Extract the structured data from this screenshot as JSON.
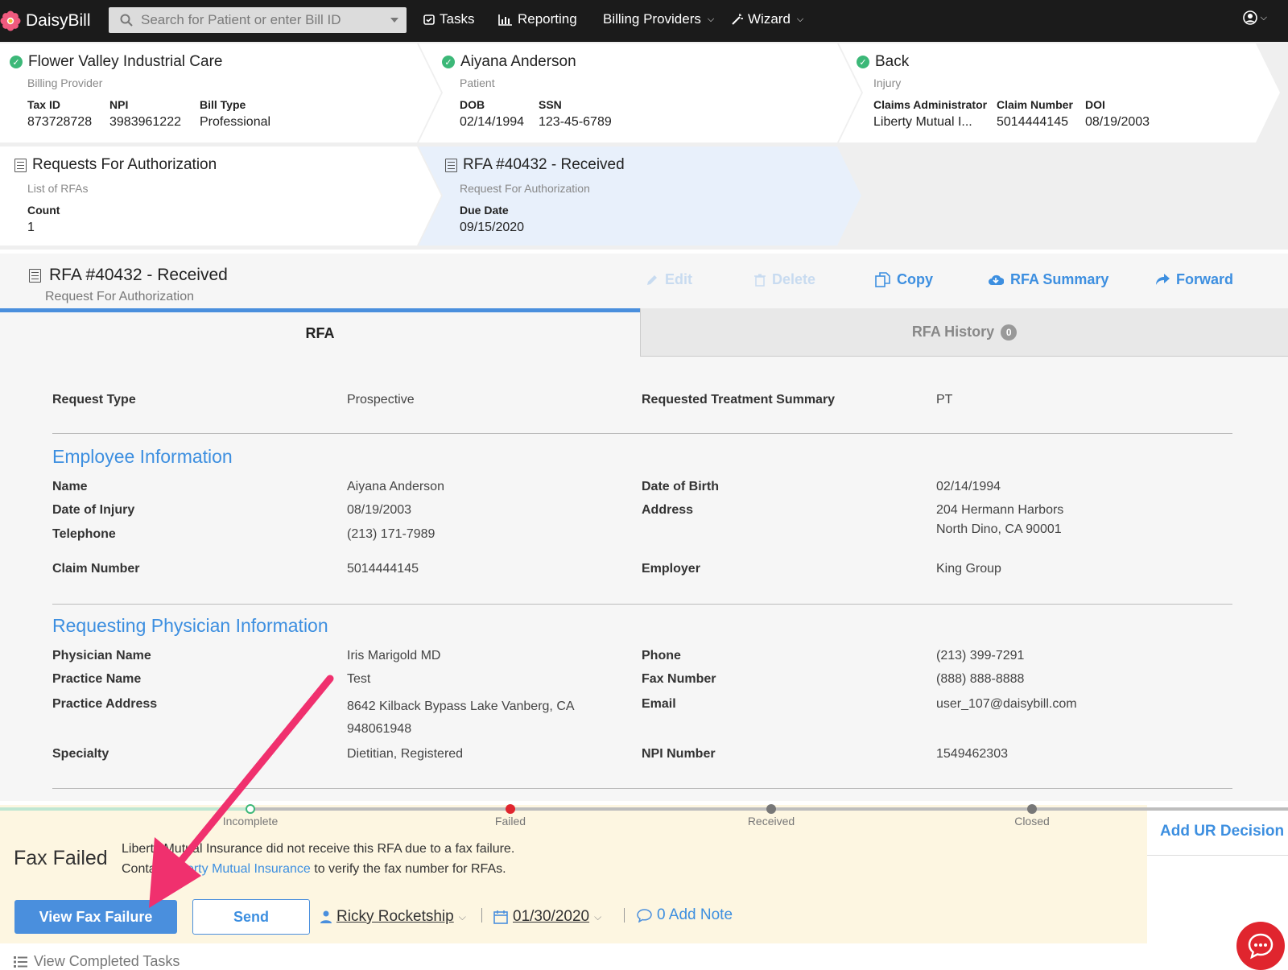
{
  "nav": {
    "brand": "DaisyBill",
    "search_placeholder": "Search for Patient or enter Bill ID",
    "tasks": "Tasks",
    "reporting": "Reporting",
    "billing_providers": "Billing Providers",
    "wizard": "Wizard"
  },
  "crumbs": {
    "provider": {
      "title": "Flower Valley Industrial Care",
      "subtitle": "Billing Provider",
      "fields": [
        {
          "label": "Tax ID",
          "value": "873728728"
        },
        {
          "label": "NPI",
          "value": "3983961222"
        },
        {
          "label": "Bill Type",
          "value": "Professional"
        }
      ]
    },
    "patient": {
      "title": "Aiyana Anderson",
      "subtitle": "Patient",
      "fields": [
        {
          "label": "DOB",
          "value": "02/14/1994"
        },
        {
          "label": "SSN",
          "value": "123-45-6789"
        }
      ]
    },
    "injury": {
      "title": "Back",
      "subtitle": "Injury",
      "fields": [
        {
          "label": "Claims Administrator",
          "value": "Liberty Mutual I..."
        },
        {
          "label": "Claim Number",
          "value": "5014444145"
        },
        {
          "label": "DOI",
          "value": "08/19/2003"
        }
      ]
    },
    "rfas": {
      "title": "Requests For Authorization",
      "subtitle": "List of RFAs",
      "fields": [
        {
          "label": "Count",
          "value": "1"
        }
      ]
    },
    "rfa": {
      "title": "RFA #40432 - Received",
      "subtitle": "Request For Authorization",
      "fields": [
        {
          "label": "Due Date",
          "value": "09/15/2020"
        }
      ]
    }
  },
  "detail": {
    "title": "RFA #40432 - Received",
    "subtitle": "Request For Authorization",
    "actions": {
      "edit": "Edit",
      "delete": "Delete",
      "copy": "Copy",
      "summary": "RFA Summary",
      "forward": "Forward"
    },
    "tabs": {
      "rfa": "RFA",
      "history": "RFA History",
      "history_count": "0"
    },
    "request_type_label": "Request Type",
    "request_type_value": "Prospective",
    "treatment_label": "Requested Treatment Summary",
    "treatment_value": "PT",
    "employee": {
      "heading": "Employee Information",
      "name_label": "Name",
      "name": "Aiyana Anderson",
      "doi_label": "Date of Injury",
      "doi": "08/19/2003",
      "phone_label": "Telephone",
      "phone": "(213) 171-7989",
      "claim_label": "Claim Number",
      "claim": "5014444145",
      "dob_label": "Date of Birth",
      "dob": "02/14/1994",
      "address_label": "Address",
      "address1": "204 Hermann Harbors",
      "address2": "North Dino, CA 90001",
      "employer_label": "Employer",
      "employer": "King Group"
    },
    "physician": {
      "heading": "Requesting Physician Information",
      "name_label": "Physician Name",
      "name": "Iris Marigold MD",
      "practice_label": "Practice Name",
      "practice": "Test",
      "address_label": "Practice Address",
      "address1": "8642 Kilback Bypass Lake Vanberg, CA",
      "address2": "948061948",
      "specialty_label": "Specialty",
      "specialty": "Dietitian, Registered",
      "phone_label": "Phone",
      "phone": "(213) 399-7291",
      "fax_label": "Fax Number",
      "fax": "(888) 888-8888",
      "email_label": "Email",
      "email": "user_107@daisybill.com",
      "npi_label": "NPI Number",
      "npi": "1549462303"
    }
  },
  "status": {
    "steps": [
      "Incomplete",
      "Failed",
      "Received",
      "Closed"
    ],
    "title": "Fax Failed",
    "line1": "Liberty Mutual Insurance did not receive this RFA due to a fax failure.",
    "line2_pre": "Contact ",
    "line2_link": "Liberty Mutual Insurance",
    "line2_post": " to verify the fax number for RFAs.",
    "view_button": "View Fax Failure",
    "send_button": "Send",
    "assignee": "Ricky Rocketship",
    "date": "01/30/2020",
    "note": "0 Add Note",
    "ur_decision": "Add UR Decision",
    "completed_tasks": "View Completed Tasks"
  },
  "colors": {
    "accent": "#4a8fdd",
    "success": "#3cb878",
    "danger": "#e0252e",
    "arrow": "#f0306e",
    "banner": "#fdf6e1"
  }
}
